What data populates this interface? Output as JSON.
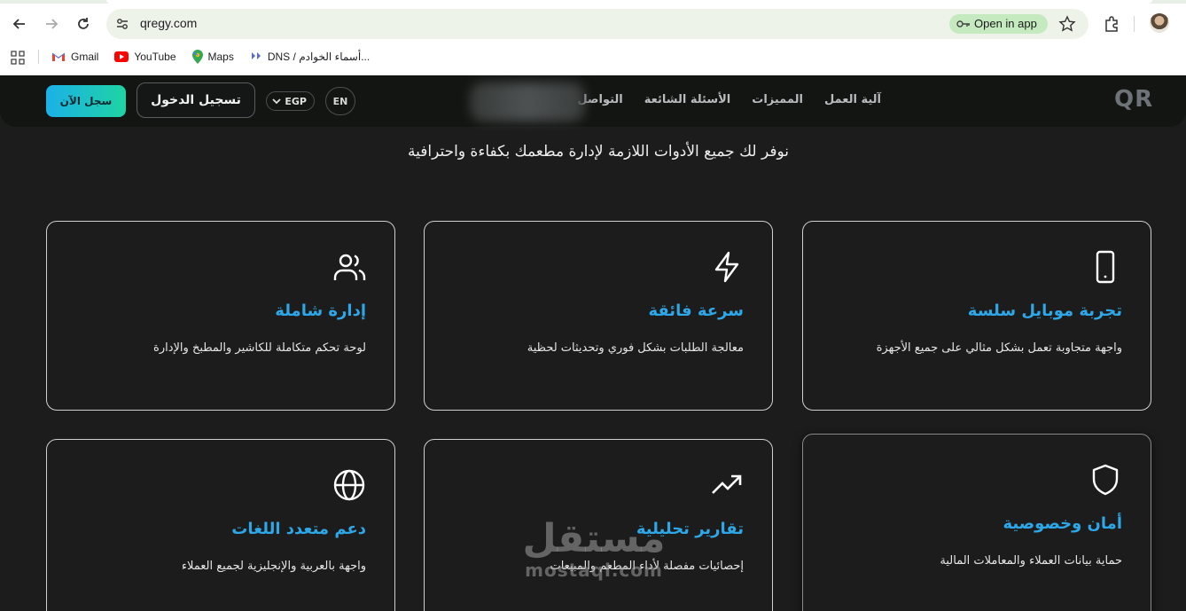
{
  "browser": {
    "url": "qregy.com",
    "open_in_app": "Open in app",
    "bookmarks": [
      "Gmail",
      "YouTube",
      "Maps",
      "DNS / أسماء الخوادم..."
    ]
  },
  "site": {
    "logo": "QR",
    "nav": [
      "آلية العمل",
      "المميزات",
      "الأسئلة الشائعة",
      "التواصل"
    ],
    "lang_button": "EN",
    "currency": "EGP",
    "login": "تسجيل الدخول",
    "signup": "سجل الآن",
    "subtitle": "نوفر لك جميع الأدوات اللازمة لإدارة مطعمك بكفاءة واحترافية",
    "features": [
      {
        "icon": "smartphone-icon",
        "title": "تجربة موبايل سلسة",
        "desc": "واجهة متجاوبة تعمل بشكل مثالي على جميع الأجهزة"
      },
      {
        "icon": "lightning-icon",
        "title": "سرعة فائقة",
        "desc": "معالجة الطلبات بشكل فوري وتحديثات لحظية"
      },
      {
        "icon": "users-icon",
        "title": "إدارة شاملة",
        "desc": "لوحة تحكم متكاملة للكاشير والمطبخ والإدارة"
      },
      {
        "icon": "shield-icon",
        "title": "أمان وخصوصية",
        "desc": "حماية بيانات العملاء والمعاملات المالية"
      },
      {
        "icon": "trending-up-icon",
        "title": "تقارير تحليلية",
        "desc": "إحصائيات مفصلة لأداء المطعم والمبيعات"
      },
      {
        "icon": "globe-icon",
        "title": "دعم متعدد اللغات",
        "desc": "واجهة بالعربية والإنجليزية لجميع العملاء"
      }
    ]
  },
  "watermark": {
    "ar": "مستقل",
    "lat": "mostaql.com"
  },
  "colors": {
    "accent": "#2ea7e8",
    "signup_gradient_start": "#1bb1e8",
    "signup_gradient_end": "#1fd3a3",
    "page_bg": "#1c1c1c"
  }
}
